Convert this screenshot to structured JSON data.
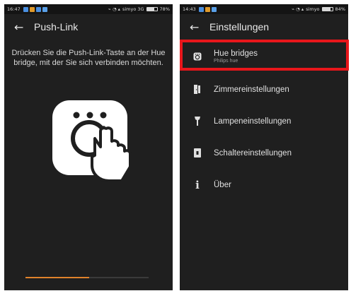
{
  "left": {
    "status": {
      "time": "16:47",
      "carrier": "simyo 3G",
      "battery": "78%"
    },
    "title": "Push-Link",
    "instruction": "Drücken Sie die Push-Link-Taste an der Hue bridge, mit der Sie sich verbinden möchten.",
    "progress": 0.52
  },
  "right": {
    "status": {
      "time": "14:43",
      "carrier": "simyo",
      "battery": "84%"
    },
    "title": "Einstellungen",
    "menu": [
      {
        "label": "Hue bridges",
        "sub": "Philips hue",
        "icon": "bridge-icon"
      },
      {
        "label": "Zimmereinstellungen",
        "icon": "door-icon"
      },
      {
        "label": "Lampeneinstellungen",
        "icon": "lamp-icon"
      },
      {
        "label": "Schaltereinstellungen",
        "icon": "switch-icon"
      },
      {
        "label": "Über",
        "icon": "info-icon"
      }
    ]
  },
  "colors": {
    "highlight": "#e8161b",
    "progress": "#e0822b",
    "background": "#1f1f1f"
  }
}
